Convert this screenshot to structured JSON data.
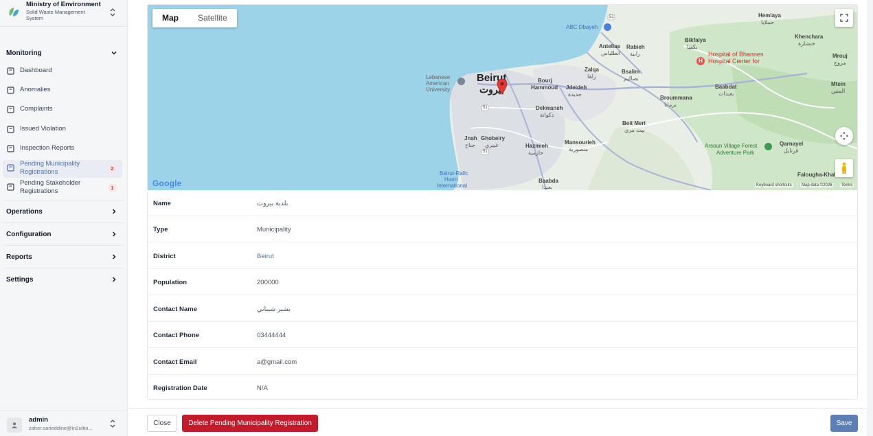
{
  "org": {
    "title": "Ministry of Environment",
    "subtitle": "Solid Waste Management System"
  },
  "sidebar": {
    "monitoring": {
      "label": "Monitoring",
      "items": [
        {
          "label": "Dashboard"
        },
        {
          "label": "Anomalies"
        },
        {
          "label": "Complaints"
        },
        {
          "label": "Issued Violation"
        },
        {
          "label": "Inspection Reports"
        },
        {
          "label": "Pending Municipality Registrations",
          "badge": "2",
          "active": true
        },
        {
          "label": "Pending Stakeholder Registrations",
          "badge": "1"
        }
      ]
    },
    "sections": [
      {
        "label": "Operations"
      },
      {
        "label": "Configuration"
      },
      {
        "label": "Reports"
      },
      {
        "label": "Settings"
      }
    ]
  },
  "user": {
    "name": "admin",
    "email": "zaher.sarieddine@in2ultio..."
  },
  "map": {
    "type_buttons": [
      "Map",
      "Satellite"
    ],
    "selected_type": "Map",
    "google": "Google",
    "footer": [
      "Keyboard shortcuts",
      "Map data ©2026",
      "Terms"
    ],
    "labels": {
      "beirut": "Beirut",
      "beirut_ar": "بيروت",
      "abc": "ABC Dbayeh",
      "antelias": "Antelias",
      "antelias_ar": "انطلياس",
      "rabieh": "Rabieh",
      "rabieh_ar": "رابية",
      "zalqa": "Zalqa",
      "zalqa_ar": "زلقا",
      "bsalim": "Bsalim",
      "bsalim_ar": "بصاليم",
      "bikfaiya": "Bikfaiya",
      "bikfaiya_ar": "بكفيا",
      "hemlaya": "Hemlaya",
      "hemlaya_ar": "حملايا",
      "khenchara": "Khenchara",
      "khenchara_ar": "خنشارة",
      "mrouj": "Mrouj",
      "mrouj_ar": "مروج",
      "hospital": "Hospital of Bhannes",
      "hospital2": "Hospital Center for",
      "baabdat": "Baabdat",
      "baabdat_ar": "بعبدات",
      "mtein": "Mtein",
      "mtein_ar": "المتين",
      "broummana": "Broummana",
      "broummana_ar": "برمانا",
      "beit_meri": "Beit Meri",
      "beit_meri_ar": "بيت مري",
      "bourj": "Bourj",
      "bourj2": "Hammoud",
      "jdeideh": "Jdeideh",
      "jdeideh_ar": "جديدة",
      "dekwaneh": "Dekwaneh",
      "dekwaneh_ar": "دكوانة",
      "mansourieh": "Mansourieh",
      "mansourieh_ar": "منصورية",
      "arsoun": "Arsoun Village Forest",
      "arsoun2": "Adventure Park",
      "qarnayel": "Qarnayel",
      "qarnayel_ar": "قرنايل",
      "faloughat": "Falougha-Khaloua",
      "lau": "Lebanese",
      "lau2": "American",
      "lau3": "University",
      "jnah": "Jnah",
      "jnah_ar": "جناح",
      "ghobeiry": "Ghobeiry",
      "ghobeiry_ar": "غبيري",
      "hazmieh": "Hazmieh",
      "hazmieh_ar": "حازمية",
      "baabda": "Baabda",
      "baabda_ar": "بعبدا",
      "airport": "Beirut-Rafic",
      "airport2": "Hariri",
      "airport3": "International",
      "road_51": "51"
    }
  },
  "details": [
    {
      "label": "Name",
      "value": "بلدية بيروت"
    },
    {
      "label": "Type",
      "value": "Municipality"
    },
    {
      "label": "District",
      "value": "Beirut",
      "link": true
    },
    {
      "label": "Population",
      "value": "200000"
    },
    {
      "label": "Contact Name",
      "value": "بشير شيباني"
    },
    {
      "label": "Contact Phone",
      "value": "03444444"
    },
    {
      "label": "Contact Email",
      "value": "a@gmail.com"
    },
    {
      "label": "Registration Date",
      "value": "N/A"
    }
  ],
  "actions": {
    "close": "Close",
    "delete": "Delete Pending Municipality Registration",
    "save": "Save"
  },
  "colors": {
    "accent": "#5c7fb5",
    "danger": "#c41b2c",
    "badge_bg": "#fde4e4",
    "water": "#9dd3e8"
  }
}
